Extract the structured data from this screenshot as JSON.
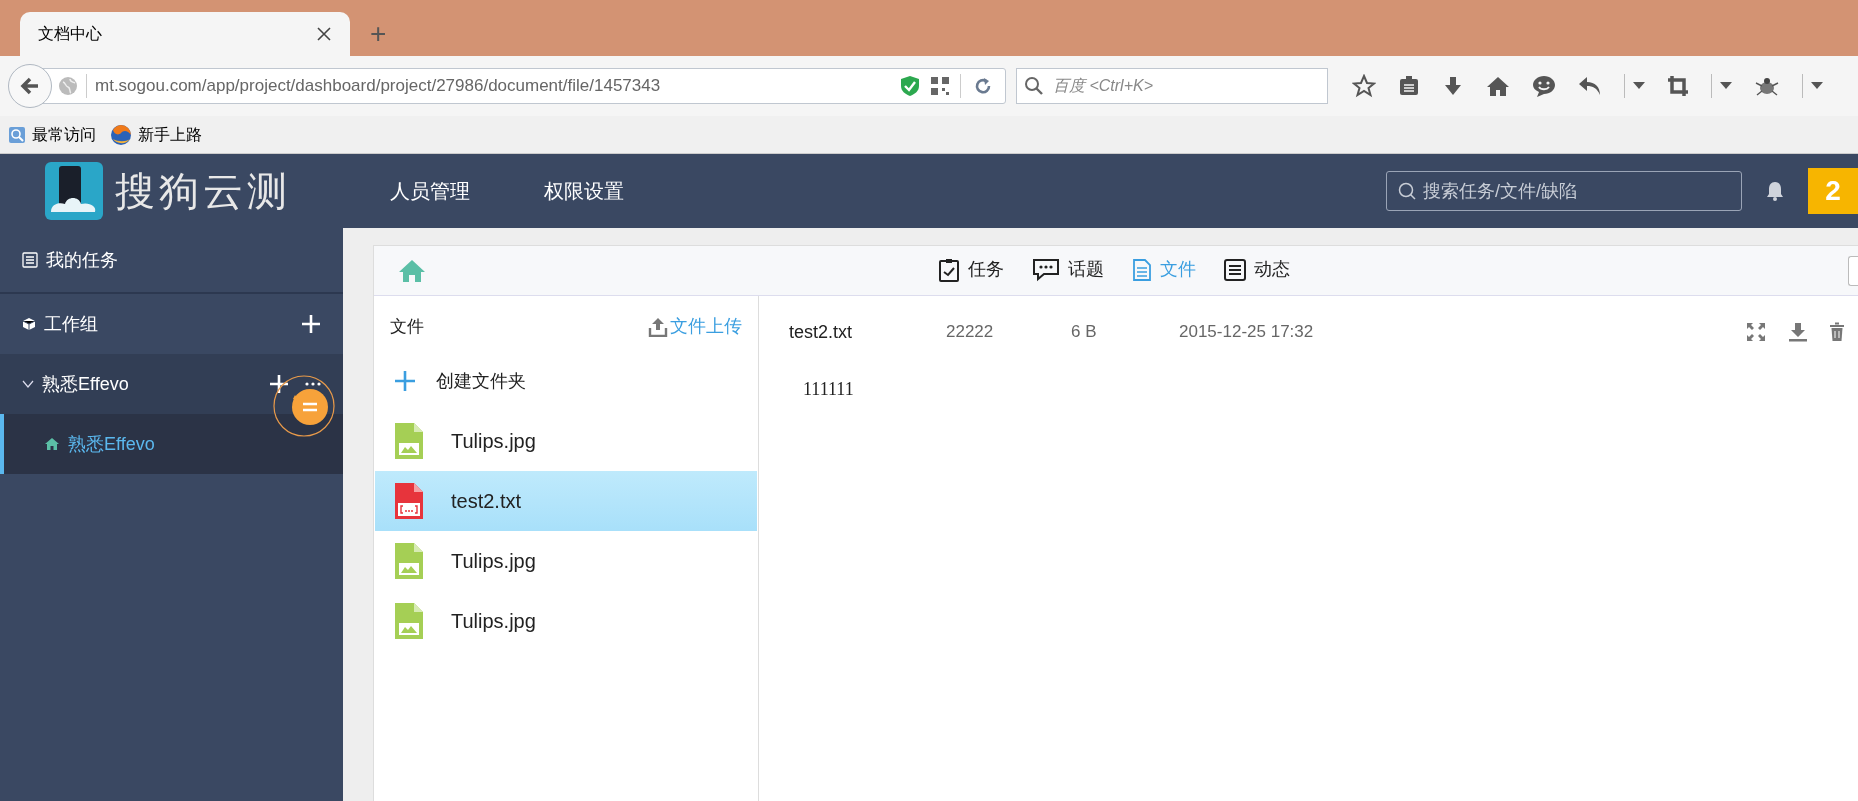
{
  "browser": {
    "tab": {
      "title": "文档中心",
      "selected": true
    },
    "new_tab": "+",
    "url": "mt.sogou.com/app/project/dashboard/project/27986/document/file/1457343",
    "search": {
      "placeholder": "百度 <Ctrl+K>"
    },
    "bookmarks": [
      {
        "label": "最常访问",
        "kind": "folder"
      },
      {
        "label": "新手上路",
        "kind": "globe"
      }
    ]
  },
  "header": {
    "logo": "搜狗云测",
    "nav": [
      "人员管理",
      "权限设置"
    ],
    "search": {
      "placeholder": "搜索任务/文件/缺陷"
    },
    "badge": "2"
  },
  "sidebar": {
    "items": [
      {
        "kind": "tasks",
        "label": "我的任务",
        "selected": false
      },
      {
        "kind": "section",
        "label": "工作组",
        "selected": false
      },
      {
        "kind": "group",
        "label": "熟悉Effevo",
        "expanded": true,
        "selected": false,
        "children": [
          {
            "kind": "project",
            "label": "熟悉Effevo",
            "selected": true
          }
        ]
      }
    ]
  },
  "toolbar": {
    "tabs": [
      {
        "kind": "tasks",
        "label": "任务",
        "selected": false
      },
      {
        "kind": "topics",
        "label": "话题",
        "selected": false
      },
      {
        "kind": "files",
        "label": "文件",
        "selected": true
      },
      {
        "kind": "activity",
        "label": "动态",
        "selected": false
      }
    ]
  },
  "files": {
    "title": "文件",
    "upload": "文件上传",
    "create_folder": "创建文件夹",
    "items": [
      {
        "name": "Tulips.jpg",
        "kind": "image",
        "selected": false
      },
      {
        "name": "test2.txt",
        "kind": "text",
        "selected": true
      },
      {
        "name": "Tulips.jpg",
        "kind": "image",
        "selected": false
      },
      {
        "name": "Tulips.jpg",
        "kind": "image",
        "selected": false
      }
    ]
  },
  "detail": {
    "name": "test2.txt",
    "column_2": "22222",
    "size": "6 B",
    "date": "2015-12-25 17:32",
    "content": "111111"
  }
}
